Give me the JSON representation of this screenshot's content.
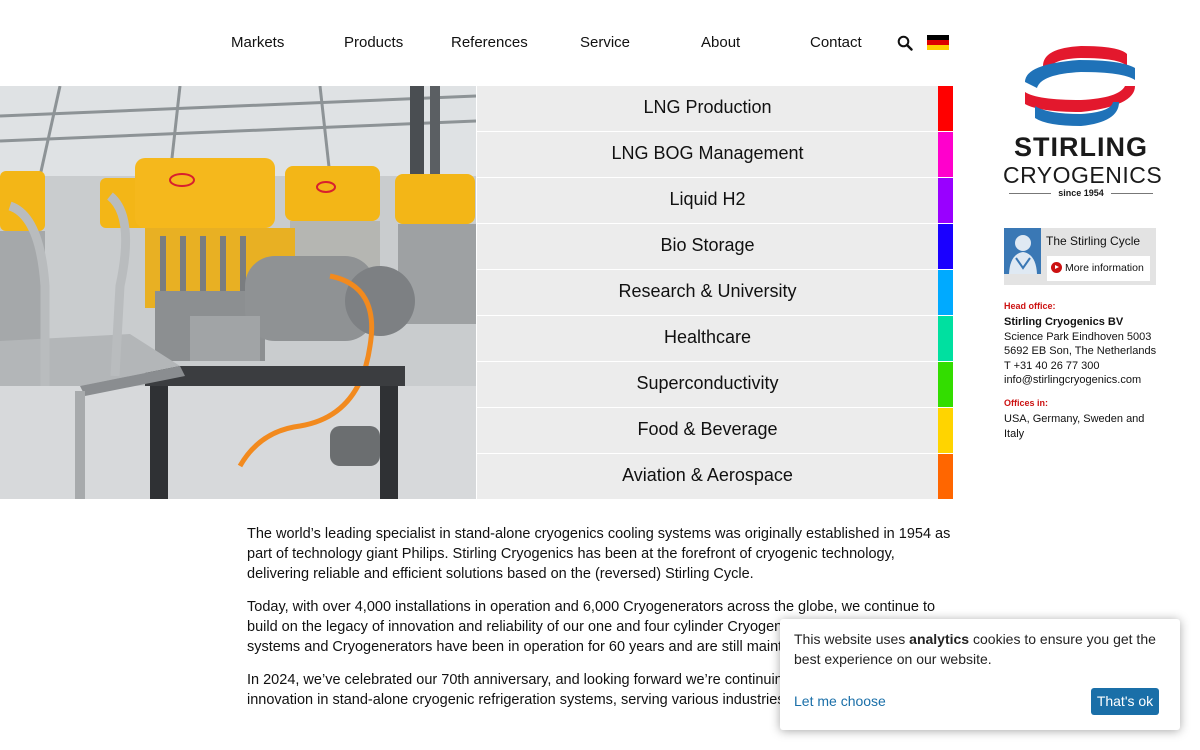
{
  "nav": {
    "items": [
      {
        "label": "Markets"
      },
      {
        "label": "Products"
      },
      {
        "label": "References"
      },
      {
        "label": "Service"
      },
      {
        "label": "About"
      },
      {
        "label": "Contact"
      }
    ],
    "search_icon": "search-icon",
    "language_flag": "german-flag-icon"
  },
  "markets": [
    {
      "label": "LNG Production",
      "color": "#ff0000"
    },
    {
      "label": "LNG BOG Management",
      "color": "#ff00cc"
    },
    {
      "label": "Liquid H2",
      "color": "#9900ff"
    },
    {
      "label": "Bio Storage",
      "color": "#1a00ff"
    },
    {
      "label": "Research & University",
      "color": "#00aaff"
    },
    {
      "label": "Healthcare",
      "color": "#00e0a0"
    },
    {
      "label": "Superconductivity",
      "color": "#33dd00"
    },
    {
      "label": "Food & Beverage",
      "color": "#ffd400"
    },
    {
      "label": "Aviation & Aerospace",
      "color": "#ff6600"
    }
  ],
  "intro": {
    "p1": "The world’s leading specialist in stand-alone cryogenics cooling systems was originally established in 1954 as part of technology giant Philips. Stirling Cryogenics has been at the forefront of cryogenic technology, delivering reliable and efficient solutions based on the (reversed) Stirling Cycle.",
    "p2": "Today, with over 4,000 installations in operation and 6,000 Cryogenerators across the globe, we continue to build on the legacy of innovation and reliability of our one and four cylinder Cryogenerators. Our oldest systems and Cryogenerators have been in operation for 60 years and are still maintained by our team.",
    "p3": "In 2024, we’ve celebrated our 70th anniversary, and looking forward we’re continuing to lead the way in innovation in stand-alone cryogenic refrigeration systems, serving various industries worldwide."
  },
  "logo": {
    "wordmark": "STIRLING",
    "sub": "CRYOGENICS",
    "since": "since 1954",
    "brand_red": "#e3182d",
    "brand_blue": "#1f72b8"
  },
  "cycle_card": {
    "title": "The Stirling Cycle",
    "more": "More information"
  },
  "office": {
    "head_heading": "Head office:",
    "company": "Stirling Cryogenics BV",
    "address1": "Science Park Eindhoven 5003",
    "address2": "5692 EB Son, The Netherlands",
    "phone": "T +31 40 26 77 300",
    "email": "info@stirlingcryogenics.com",
    "offices_heading": "Offices in:",
    "offices": "USA, Germany, Sweden and Italy"
  },
  "cookie": {
    "text_before": "This website uses ",
    "text_bold": "analytics",
    "text_after": " cookies to ensure you get the best experience on our website.",
    "choose": "Let me choose",
    "ok": "That's ok"
  }
}
